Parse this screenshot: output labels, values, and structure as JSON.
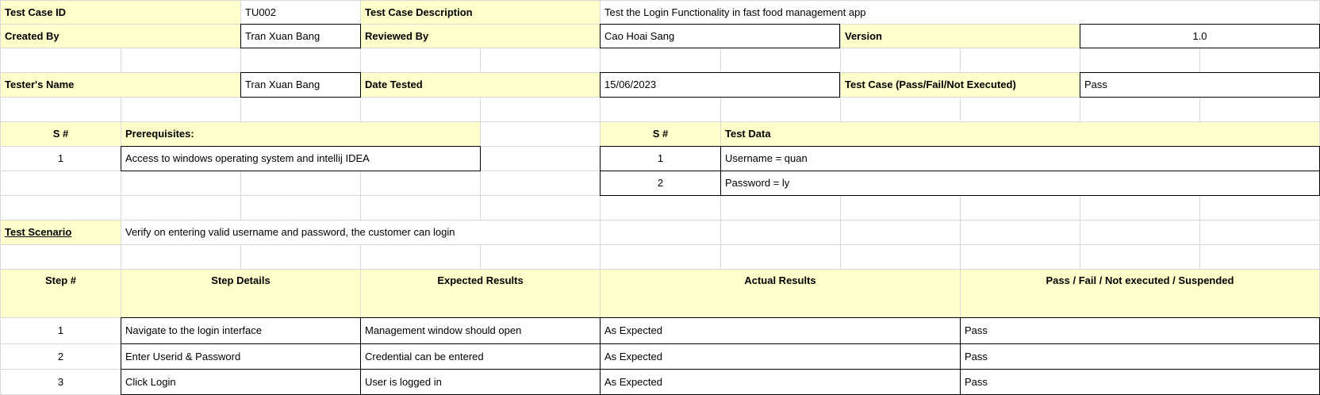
{
  "header": {
    "test_case_id_label": "Test Case ID",
    "test_case_id": "TU002",
    "description_label": "Test Case Description",
    "description": "Test the Login Functionality in fast food management app",
    "created_by_label": "Created By",
    "created_by": "Tran Xuan Bang",
    "reviewed_by_label": "Reviewed By",
    "reviewed_by": "Cao Hoai Sang",
    "version_label": "Version",
    "version": "1.0",
    "tester_label": "Tester's Name",
    "tester": "Tran Xuan Bang",
    "date_label": "Date Tested",
    "date": "15/06/2023",
    "result_label": "Test Case (Pass/Fail/Not Executed)",
    "result": "Pass"
  },
  "prerequisites": {
    "sn_header": "S #",
    "header": "Prerequisites:",
    "rows": [
      {
        "sn": "1",
        "text": "Access to windows operating system and intellij IDEA"
      }
    ]
  },
  "test_data": {
    "sn_header": "S #",
    "header": "Test Data",
    "rows": [
      {
        "sn": "1",
        "text": "Username = quan"
      },
      {
        "sn": "2",
        "text": "Password = ly"
      }
    ]
  },
  "scenario": {
    "label": "Test Scenario",
    "text": "Verify on entering valid username and password, the customer can login"
  },
  "steps": {
    "headers": {
      "step": "Step #",
      "details": "Step Details",
      "expected": "Expected Results",
      "actual": "Actual Results",
      "status": "Pass / Fail / Not executed / Suspended"
    },
    "rows": [
      {
        "step": "1",
        "details": "Navigate to the login interface",
        "expected": "Management window should open",
        "actual": "As Expected",
        "status": "Pass"
      },
      {
        "step": "2",
        "details": "Enter Userid & Password",
        "expected": "Credential can be entered",
        "actual": "As Expected",
        "status": "Pass"
      },
      {
        "step": "3",
        "details": "Click Login",
        "expected": "User is logged in",
        "actual": "As Expected",
        "status": "Pass"
      }
    ]
  },
  "colors": {
    "header_fill": "#ffffcc",
    "gridline": "#d9d9d9",
    "border": "#000000"
  }
}
